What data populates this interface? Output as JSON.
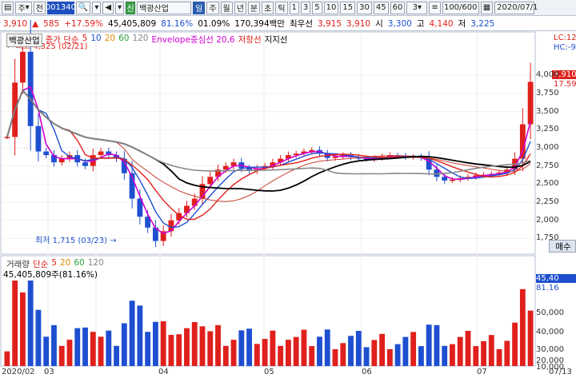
{
  "toolbar": {
    "dropdown_label": "주",
    "prefix_label": "전",
    "code_value": "001340",
    "name_label": "백광산업",
    "periods": [
      "일",
      "주",
      "월",
      "년",
      "분",
      "초",
      "틱"
    ],
    "minutes": [
      "1",
      "3",
      "5",
      "10",
      "15",
      "30",
      "45",
      "60"
    ],
    "selected_min": "3",
    "count_value": "100/600",
    "date_value": "2020/07/1"
  },
  "info": {
    "price": "3,910",
    "change": "585",
    "pct": "+17.59%",
    "volume": "45,405,809",
    "vol_pct": "81.16%",
    "turnover": "01.09%",
    "amount": "170,394백만",
    "pref_label": "최우선",
    "pref1": "3,915",
    "pref2": "3,910",
    "open_label": "시",
    "open": "3,300",
    "high_label": "고",
    "high": "4,140",
    "low_label": "저",
    "low": "3,225"
  },
  "main_legend": {
    "name": "백광산업",
    "ma_label": "종가 단순",
    "ma_values": [
      "5",
      "10",
      "20",
      "60",
      "120"
    ],
    "env_label": "Envelope중심선 20,6",
    "resist": "저항선",
    "support": "지지선"
  },
  "annotations": {
    "high_note": "최고 4,325 (02/21)",
    "low_note": "최저 1,715 (03/23)"
  },
  "right_labels": {
    "lc": "LC:127",
    "hc": "HC:-9",
    "price_box": "3,910",
    "pct_box": "17.59"
  },
  "y_axis_price": [
    "4,000",
    "3,750",
    "3,500",
    "3,250",
    "3,000",
    "2,750",
    "2,500",
    "2,250",
    "2,000",
    "1,750"
  ],
  "buy_label": "매수",
  "vol_legend": {
    "name": "거래량",
    "ma_label": "단순",
    "ma_values": [
      "5",
      "20",
      "60",
      "120"
    ],
    "current": "45,405,809주(81.16%)"
  },
  "y_axis_vol": [
    "45,40",
    "81.16",
    "50,000",
    "40,000",
    "30,000",
    "20,000",
    "10,000"
  ],
  "x_labels": [
    "2020/02",
    "03",
    "04",
    "05",
    "06",
    "07",
    "07/13"
  ],
  "chart_data": {
    "type": "candlestick",
    "close_series": [
      3150,
      3900,
      4325,
      3300,
      2950,
      2900,
      2800,
      2850,
      2900,
      2800,
      2750,
      2900,
      2950,
      2900,
      2850,
      2650,
      2300,
      2050,
      1900,
      1715,
      1850,
      2000,
      2100,
      2200,
      2300,
      2500,
      2600,
      2700,
      2750,
      2800,
      2720,
      2680,
      2720,
      2750,
      2800,
      2850,
      2900,
      2920,
      2950,
      2970,
      2920,
      2860,
      2880,
      2900,
      2870,
      2850,
      2840,
      2860,
      2880,
      2900,
      2890,
      2870,
      2880,
      2860,
      2700,
      2600,
      2550,
      2560,
      2580,
      2600,
      2620,
      2630,
      2640,
      2660,
      2700,
      2850,
      3325,
      3910
    ],
    "ylim": [
      1600,
      4400
    ],
    "y_ticks": [
      4000,
      3750,
      3500,
      3250,
      3000,
      2750,
      2500,
      2250,
      2000,
      1750
    ]
  }
}
